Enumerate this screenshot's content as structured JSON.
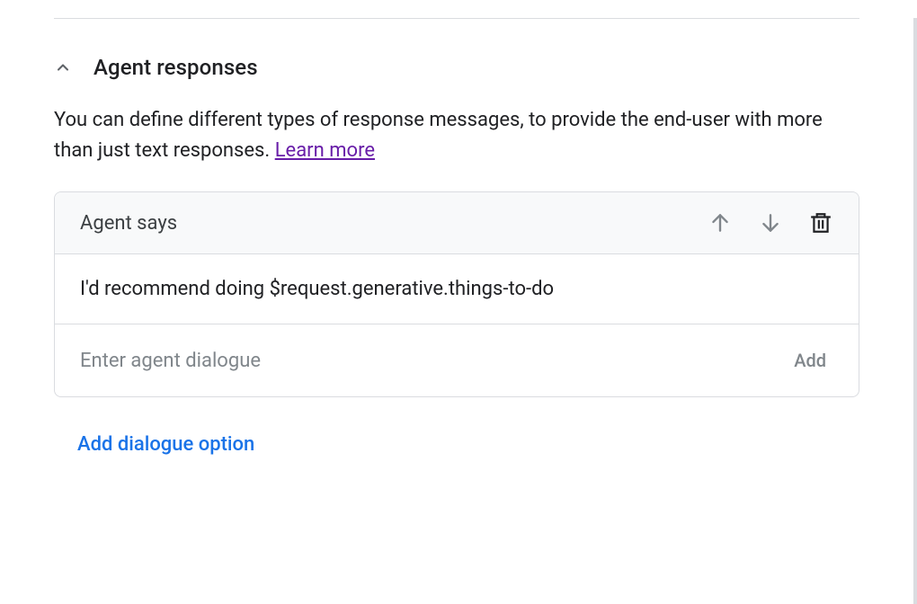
{
  "section": {
    "title": "Agent responses",
    "description": "You can define different types of response messages, to provide the end-user with more than just text responses. ",
    "learn_more": "Learn more"
  },
  "card": {
    "header_title": "Agent says",
    "response_text": "I'd recommend doing $request.generative.things-to-do",
    "input_placeholder": "Enter agent dialogue",
    "add_button": "Add"
  },
  "add_dialogue_option": "Add dialogue option"
}
